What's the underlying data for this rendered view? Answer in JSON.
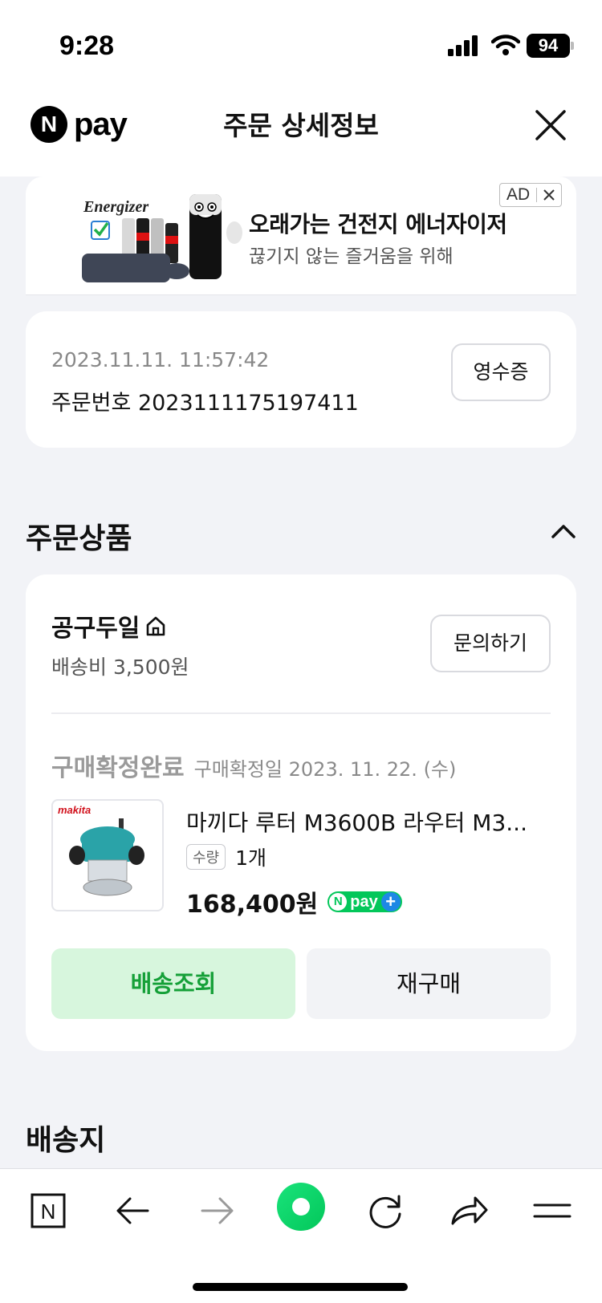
{
  "status_bar": {
    "time": "9:28",
    "battery": "94"
  },
  "header": {
    "logo_letter": "N",
    "logo_text": "pay",
    "title": "주문 상세정보"
  },
  "ad": {
    "title": "오래가는 건전지 에너자이저",
    "subtitle": "끊기지 않는 즐거움을 위해",
    "badge": "AD",
    "brand": "Energizer"
  },
  "order": {
    "date": "2023.11.11. 11:57:42",
    "number": "주문번호 2023111175197411",
    "receipt_label": "영수증"
  },
  "products_section": {
    "title": "주문상품"
  },
  "seller": {
    "name": "공구두일",
    "shipping_fee": "배송비 3,500원",
    "inquiry_label": "문의하기"
  },
  "item": {
    "status": "구매확정완료",
    "confirm_date": "구매확정일 2023. 11. 22. (수)",
    "name": "마끼다 루터 M3600B 라우터 M3...",
    "qty_label": "수량",
    "qty_value": "1개",
    "price": "168,400원",
    "brand": "makita",
    "npay_badge": {
      "letter": "N",
      "text": "pay",
      "plus": "+"
    }
  },
  "actions": {
    "track_label": "배송조회",
    "rebuy_label": "재구매"
  },
  "delivery_section": {
    "title": "배송지"
  },
  "bottom_nav": {
    "home_letter": "N"
  },
  "colors": {
    "npay_green": "#03c75a",
    "track_button_bg": "#d7f6dd",
    "track_button_text": "#15a038",
    "page_bg": "#f2f3f7"
  }
}
